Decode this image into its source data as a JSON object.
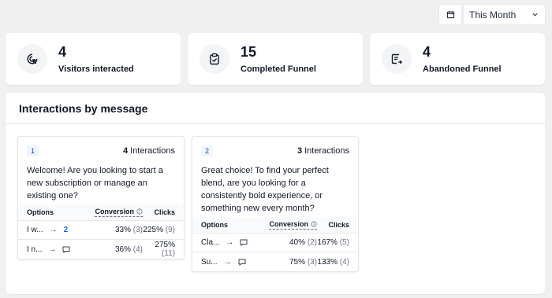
{
  "toolbar": {
    "date_icon": "calendar-icon",
    "period_value": "This Month",
    "chevron_icon": "chevron-down-icon"
  },
  "stats": [
    {
      "icon": "cursor-click-icon",
      "value": "4",
      "label": "Visitors interacted"
    },
    {
      "icon": "clipboard-check-icon",
      "value": "15",
      "label": "Completed Funnel"
    },
    {
      "icon": "list-exit-icon",
      "value": "4",
      "label": "Abandoned Funnel"
    }
  ],
  "panel": {
    "title": "Interactions by message"
  },
  "messages": [
    {
      "index": "1",
      "count": "4",
      "count_label": "Interactions",
      "text": "Welcome! Are you looking to start a new subscription or manage an existing one?",
      "headers": {
        "options": "Options",
        "conversion": "Conversion",
        "clicks": "Clicks"
      },
      "rows": [
        {
          "option": "I w...",
          "arrow": "→",
          "target": "2",
          "target_icon": "",
          "conv": "33%",
          "conv_count": "(3)",
          "clicks": "225%",
          "clicks_count": "(9)"
        },
        {
          "option": "I n...",
          "arrow": "→",
          "target": "",
          "target_icon": "message-icon",
          "conv": "36%",
          "conv_count": "(4)",
          "clicks": "275%",
          "clicks_count": "(11)"
        }
      ]
    },
    {
      "index": "2",
      "count": "3",
      "count_label": "Interactions",
      "text": "Great choice! To find your perfect blend, are you looking for a consistently bold experience, or something new every month?",
      "headers": {
        "options": "Options",
        "conversion": "Conversion",
        "clicks": "Clicks"
      },
      "rows": [
        {
          "option": "Cla...",
          "arrow": "→",
          "target": "",
          "target_icon": "message-icon",
          "conv": "40%",
          "conv_count": "(2)",
          "clicks": "167%",
          "clicks_count": "(5)"
        },
        {
          "option": "Su...",
          "arrow": "→",
          "target": "",
          "target_icon": "message-icon",
          "conv": "75%",
          "conv_count": "(3)",
          "clicks": "133%",
          "clicks_count": "(4)"
        }
      ]
    }
  ]
}
